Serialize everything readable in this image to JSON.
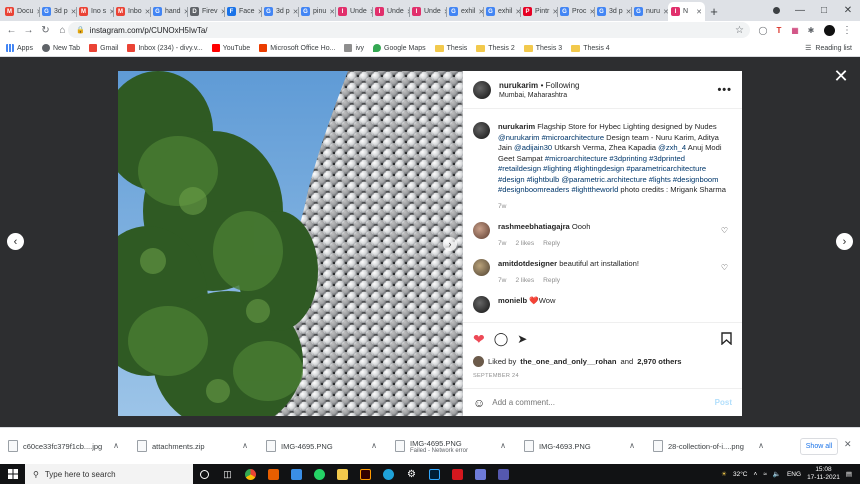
{
  "browser": {
    "tabs": [
      {
        "label": "Docu",
        "icon": "gmail-icon",
        "color": "#ea4335",
        "letter": "M"
      },
      {
        "label": "3d p",
        "icon": "google-icon",
        "color": "#4285f4",
        "letter": "G"
      },
      {
        "label": "Ino s",
        "icon": "gmail-icon",
        "color": "#ea4335",
        "letter": "M"
      },
      {
        "label": "Inbo",
        "icon": "gmail-icon",
        "color": "#ea4335",
        "letter": "M"
      },
      {
        "label": "hand",
        "icon": "google-icon",
        "color": "#4285f4",
        "letter": "G"
      },
      {
        "label": "Firev",
        "icon": "document-icon",
        "color": "#5f6368",
        "letter": "D"
      },
      {
        "label": "Face",
        "icon": "globe-icon",
        "color": "#1a73e8",
        "letter": "F"
      },
      {
        "label": "3d p",
        "icon": "google-icon",
        "color": "#4285f4",
        "letter": "G"
      },
      {
        "label": "pinu",
        "icon": "google-icon",
        "color": "#4285f4",
        "letter": "G"
      },
      {
        "label": "Unde",
        "icon": "instagram-icon",
        "color": "#e1306c",
        "letter": "I"
      },
      {
        "label": "Unde",
        "icon": "instagram-icon",
        "color": "#e1306c",
        "letter": "I"
      },
      {
        "label": "Unde",
        "icon": "instagram-icon",
        "color": "#e1306c",
        "letter": "I"
      },
      {
        "label": "exhil",
        "icon": "google-icon",
        "color": "#4285f4",
        "letter": "G"
      },
      {
        "label": "exhil",
        "icon": "google-icon",
        "color": "#4285f4",
        "letter": "G"
      },
      {
        "label": "Pintr",
        "icon": "pinterest-icon",
        "color": "#e60023",
        "letter": "P"
      },
      {
        "label": "Proc",
        "icon": "google-icon",
        "color": "#4285f4",
        "letter": "G"
      },
      {
        "label": "3d p",
        "icon": "google-icon",
        "color": "#4285f4",
        "letter": "G"
      },
      {
        "label": "nuru",
        "icon": "google-icon",
        "color": "#4285f4",
        "letter": "G"
      },
      {
        "label": "N",
        "icon": "instagram-icon",
        "color": "#e1306c",
        "letter": "I",
        "active": true
      }
    ],
    "url": "instagram.com/p/CUNOxH5IwTa/",
    "bookmarks": {
      "apps": "Apps",
      "new_tab": "New Tab",
      "gmail": "Gmail",
      "inbox": "Inbox (234) - divy.v...",
      "youtube": "YouTube",
      "office": "Microsoft Office Ho...",
      "ivy": "ivy",
      "maps": "Google Maps",
      "thesis": "Thesis",
      "thesis2": "Thesis 2",
      "thesis3": "Thesis 3",
      "thesis4": "Thesis 4",
      "reading_list": "Reading list"
    }
  },
  "post": {
    "username": "nurukarim",
    "following": "Following",
    "location": "Mumbai, Maharashtra",
    "caption": {
      "username": "nurukarim",
      "text_1": "Flagship Store for Hybec Lighting designed by Nudes ",
      "tags_1": "@nurukarim #microarchitecture",
      "text_2": " Design team - Nuru Karim, Aditya Jain ",
      "tags_2": "@adijain30",
      "text_3": " Utkarsh Verma, Zhea Kapadia ",
      "tags_3": "@zxh_4",
      "text_4": " Anuj Modi Geet Sampat ",
      "tags_4": "#microarchitecture #3dprinting #3dprinted #retaildesign #lighting #lightingdesign #parametricarchitecture #design #lightbulb @parametric.architecture #lights #designboom #designboomreaders #lighttheworld",
      "text_5": " photo credits : Mrigank Sharma",
      "time": "7w"
    },
    "comments": [
      {
        "user": "rashmeebhatiagajra",
        "text": "Oooh",
        "time": "7w",
        "likes": "2 likes",
        "reply": "Reply"
      },
      {
        "user": "amitdotdesigner",
        "text": "beautiful art installation!",
        "time": "7w",
        "likes": "2 likes",
        "reply": "Reply"
      },
      {
        "user": "monielb",
        "text": "❤️Wow",
        "time": "",
        "likes": "",
        "reply": ""
      }
    ],
    "liked_by": {
      "prefix": "Liked by ",
      "user": "the_one_and_only__rohan",
      "middle": " and ",
      "count": "2,970 others"
    },
    "date": "SEPTEMBER 24",
    "add_comment_placeholder": "Add a comment...",
    "post_label": "Post"
  },
  "downloads": {
    "items": [
      {
        "name": "c60ce33fc379f1cb....jpg",
        "sub": ""
      },
      {
        "name": "attachments.zip",
        "sub": ""
      },
      {
        "name": "IMG-4695.PNG",
        "sub": ""
      },
      {
        "name": "IMG-4695.PNG",
        "sub": "Failed - Network error"
      },
      {
        "name": "IMG-4693.PNG",
        "sub": ""
      },
      {
        "name": "28-collection-of-i....png",
        "sub": ""
      }
    ],
    "show_all": "Show all"
  },
  "taskbar": {
    "search_placeholder": "Type here to search",
    "weather": "32°C",
    "lang": "ENG",
    "time": "15:08",
    "date": "17-11-2021"
  },
  "colors": {
    "accent_blue": "#0095f6",
    "tag_blue": "#00376b",
    "like_red": "#ed4956",
    "dark_overlay": "#2d2e30"
  }
}
